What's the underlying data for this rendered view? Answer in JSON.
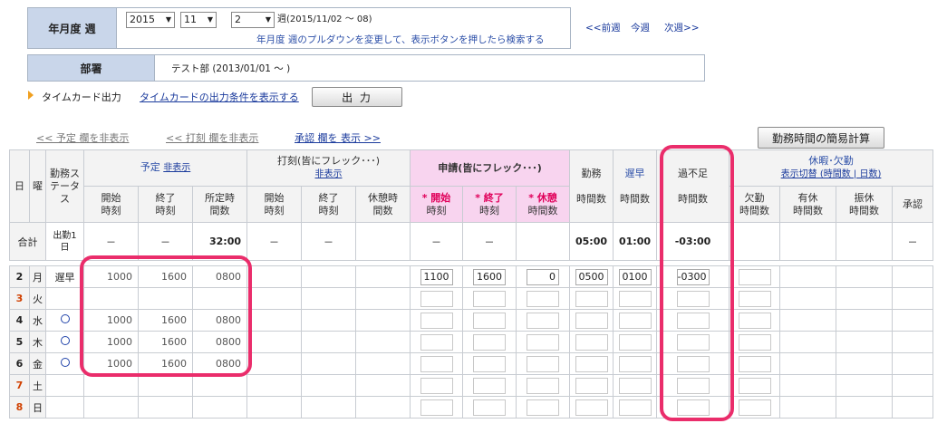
{
  "period": {
    "label": "年月度 週",
    "year": "2015",
    "month": "11",
    "week": "2",
    "week_range": "週(2015/11/02 ～ 08)",
    "hint": "年月度 週のプルダウンを変更して、表示ボタンを押したら検索する"
  },
  "nav": {
    "prev": "<<前週",
    "this": "今週",
    "next": "次週>>"
  },
  "dept": {
    "label": "部署",
    "value": "テスト部 (2013/01/01 ～ )"
  },
  "timecard": {
    "label": "タイムカード出力",
    "link": "タイムカードの出力条件を表示する",
    "button": "出 力"
  },
  "toggles": {
    "plan": "<< 予定 欄を非表示",
    "stamp": "<< 打刻 欄を非表示",
    "approve": "承認 欄を 表示 >>"
  },
  "calc_button": "勤務時間の簡易計算",
  "headers": {
    "day": "日",
    "dow": "曜",
    "kinmu": "勤務ステータス",
    "plan": "予定",
    "plan_hide": "非表示",
    "stamp": "打刻(皆にフレック･･･)",
    "stamp_hide": "非表示",
    "apply": "申請(皆にフレック･･･)",
    "work": "勤務",
    "late": "遅早",
    "over": "過不足",
    "leave": "休暇･欠勤",
    "leave_toggle": "表示切替 (時間数 | 日数)",
    "start": "開始時刻",
    "end": "終了時刻",
    "planned": "所定時間数",
    "rest": "休憩時間数",
    "apply_start": "* 開始",
    "apply_end": "* 終了",
    "apply_rest": "* 休憩",
    "time_word": "時刻",
    "hours_word": "時間数",
    "absent": "欠勤",
    "paid": "有休",
    "sub": "振休",
    "approve": "承認"
  },
  "totals": {
    "label": "合計",
    "kinmu": "出勤1日",
    "plan_start": "－",
    "plan_end": "－",
    "plan_hours": "32:00",
    "stamp_start": "－",
    "stamp_end": "－",
    "apply_start": "－",
    "apply_end": "－",
    "work": "05:00",
    "late": "01:00",
    "over": "-03:00",
    "approve": "－"
  },
  "rows": [
    {
      "day": "2",
      "dow": "月",
      "status": "遅早",
      "ps": "1000",
      "pe": "1600",
      "ph": "0800",
      "as": "1100",
      "ae": "1600",
      "ar": "0",
      "wk": "0500",
      "lt": "0100",
      "ov": "-0300"
    },
    {
      "day": "3",
      "dow": "火",
      "status": "",
      "ps": "",
      "pe": "",
      "ph": "",
      "as": "",
      "ae": "",
      "ar": "",
      "wk": "",
      "lt": "",
      "ov": ""
    },
    {
      "day": "4",
      "dow": "水",
      "status": "○",
      "ps": "1000",
      "pe": "1600",
      "ph": "0800",
      "as": "",
      "ae": "",
      "ar": "",
      "wk": "",
      "lt": "",
      "ov": ""
    },
    {
      "day": "5",
      "dow": "木",
      "status": "○",
      "ps": "1000",
      "pe": "1600",
      "ph": "0800",
      "as": "",
      "ae": "",
      "ar": "",
      "wk": "",
      "lt": "",
      "ov": ""
    },
    {
      "day": "6",
      "dow": "金",
      "status": "○",
      "ps": "1000",
      "pe": "1600",
      "ph": "0800",
      "as": "",
      "ae": "",
      "ar": "",
      "wk": "",
      "lt": "",
      "ov": ""
    },
    {
      "day": "7",
      "dow": "土",
      "status": "",
      "ps": "",
      "pe": "",
      "ph": "",
      "as": "",
      "ae": "",
      "ar": "",
      "wk": "",
      "lt": "",
      "ov": ""
    },
    {
      "day": "8",
      "dow": "日",
      "status": "",
      "ps": "",
      "pe": "",
      "ph": "",
      "as": "",
      "ae": "",
      "ar": "",
      "wk": "",
      "lt": "",
      "ov": ""
    }
  ],
  "colors": {
    "header_bg": "#c9d6ea",
    "apply_pink": "#f8d4ef",
    "annotation": "#ea2d6b",
    "weekend_day": "#d04000"
  }
}
